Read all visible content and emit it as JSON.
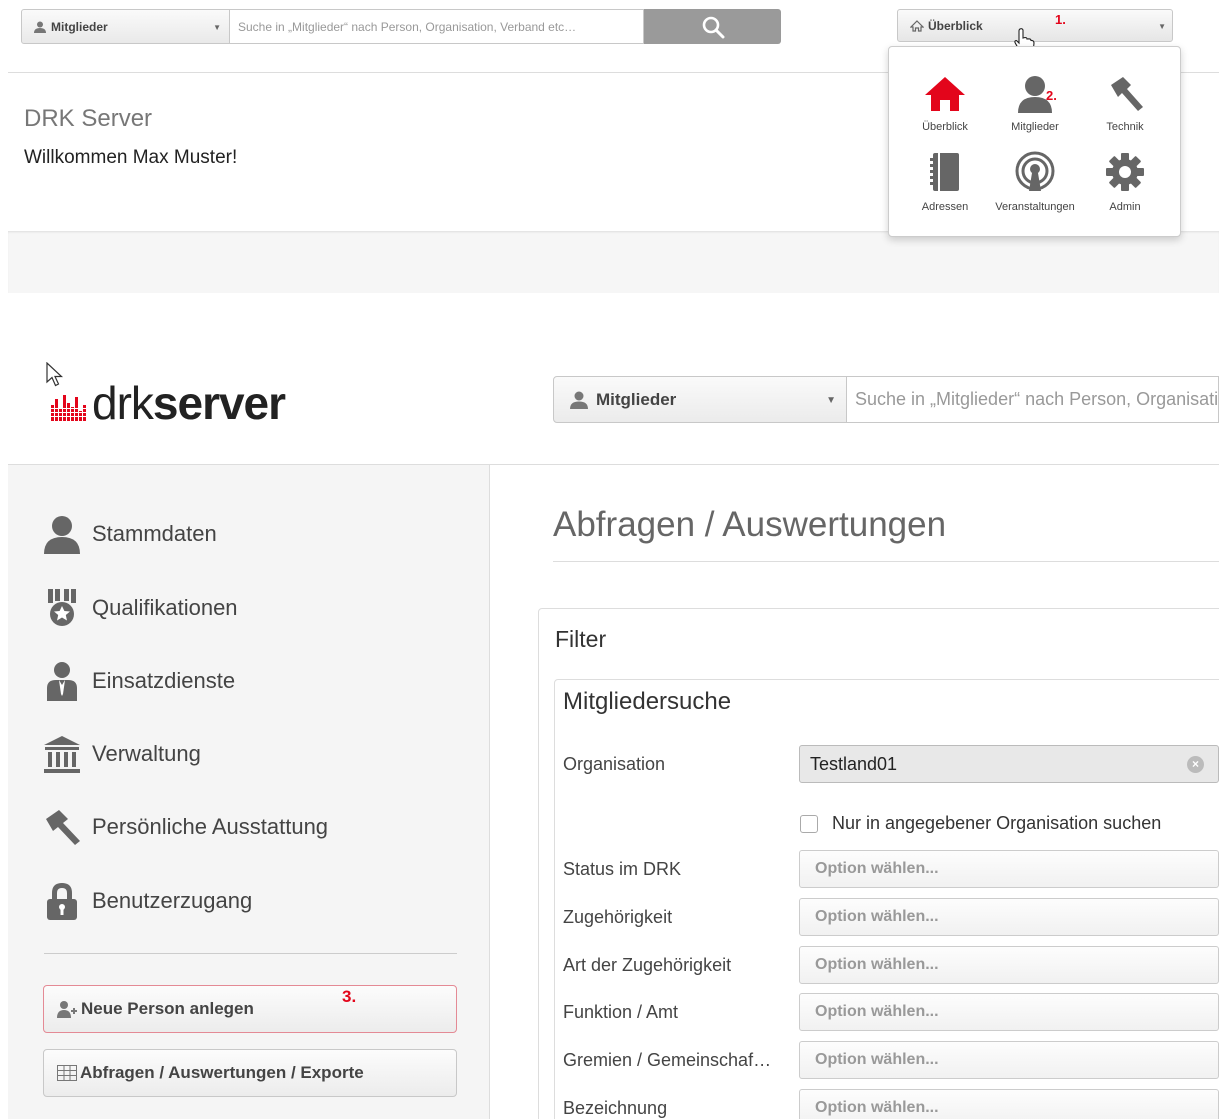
{
  "top": {
    "search_scope": "Mitglieder",
    "search_placeholder": "Suche in „Mitglieder“ nach Person, Organisation, Verband etc…",
    "overview_button": "Überblick",
    "step1": "1.",
    "step2": "2.",
    "server_title": "DRK Server",
    "welcome": "Willkommen Max Muster!",
    "menu": [
      {
        "label": "Überblick",
        "icon": "home-icon",
        "color": "#e3051b"
      },
      {
        "label": "Mitglieder",
        "icon": "person-icon"
      },
      {
        "label": "Technik",
        "icon": "hammer-icon"
      },
      {
        "label": "Adressen",
        "icon": "address-book-icon"
      },
      {
        "label": "Veranstaltungen",
        "icon": "broadcast-icon"
      },
      {
        "label": "Admin",
        "icon": "gear-icon"
      }
    ]
  },
  "logo": {
    "text_light": "drk",
    "text_bold": "server"
  },
  "main_search": {
    "scope": "Mitglieder",
    "placeholder": "Suche in „Mitglieder“ nach Person, Organisation, Verband etc…"
  },
  "sidebar": {
    "items": [
      {
        "label": "Stammdaten",
        "icon": "person-icon"
      },
      {
        "label": "Qualifikationen",
        "icon": "medal-icon"
      },
      {
        "label": "Einsatzdienste",
        "icon": "staff-icon"
      },
      {
        "label": "Verwaltung",
        "icon": "bank-icon"
      },
      {
        "label": "Persönliche Ausstattung",
        "icon": "hammer-icon"
      },
      {
        "label": "Benutzerzugang",
        "icon": "lock-icon"
      }
    ],
    "new_person": "Neue Person anlegen",
    "step3": "3.",
    "queries": "Abfragen / Auswertungen / Exporte"
  },
  "content": {
    "title": "Abfragen / Auswertungen",
    "filter_label": "Filter",
    "member_search_title": "Mitgliedersuche",
    "organisation_label": "Organisation",
    "organisation_value": "Testland01",
    "checkbox_label": "Nur in angegebener Organisation suchen",
    "option_placeholder": "Option wählen...",
    "rows": [
      "Status im DRK",
      "Zugehörigkeit",
      "Art der Zugehörigkeit",
      "Funktion / Amt",
      "Gremien / Gemeinschaf…",
      "Bezeichnung"
    ]
  },
  "colors": {
    "accent": "#e3051b",
    "grey_button": "#9a9a9a"
  }
}
